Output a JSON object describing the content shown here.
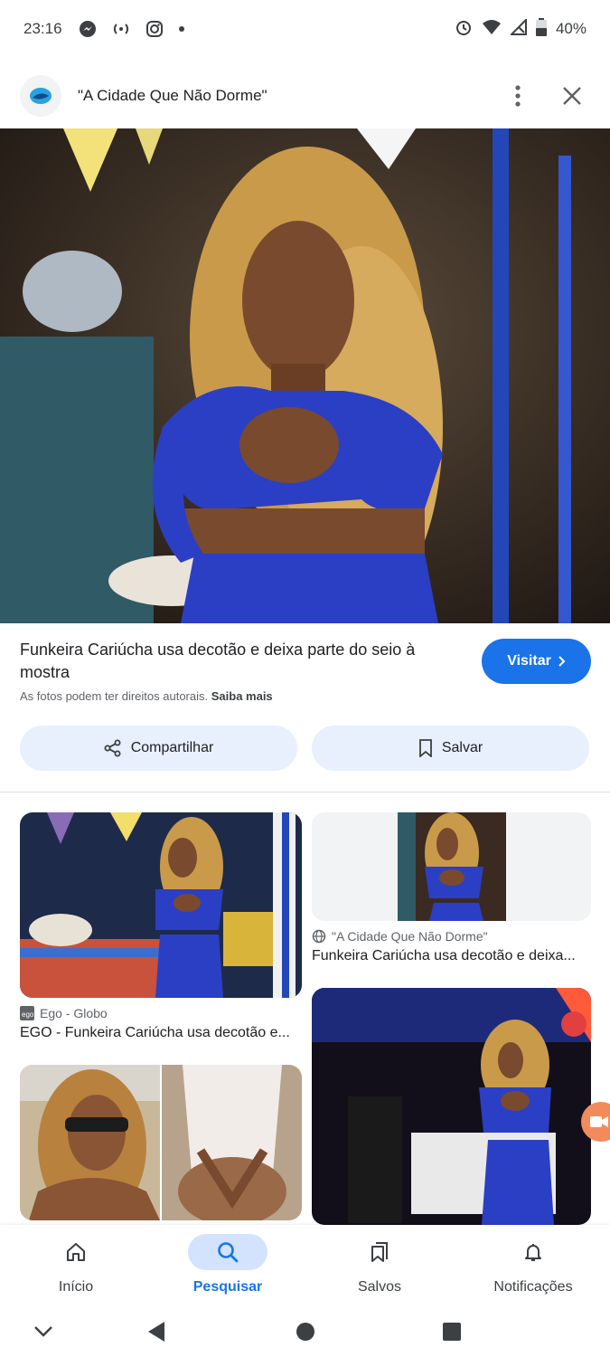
{
  "status_bar": {
    "time": "23:16",
    "battery": "40%",
    "icons": [
      "messenger-icon",
      "broadcast-icon",
      "instagram-icon",
      "dot-icon",
      "alarm-icon",
      "wifi-icon",
      "signal-icon",
      "battery-icon"
    ]
  },
  "header": {
    "title": "\"A Cidade Que Não Dorme\""
  },
  "result": {
    "caption": "Funkeira Cariúcha usa decotão e deixa parte do seio à mostra",
    "visit_label": "Visitar",
    "rights_text": "As fotos podem ter direitos autorais.",
    "learn_more": "Saiba mais",
    "share_label": "Compartilhar",
    "save_label": "Salvar"
  },
  "related": [
    {
      "source": "Ego - Globo",
      "title": "EGO - Funkeira Cariúcha usa decotão e..."
    },
    {
      "source": "\"A Cidade Que Não Dorme\"",
      "title": "Funkeira Cariúcha usa decotão e deixa..."
    }
  ],
  "bottom_nav": [
    {
      "label": "Início",
      "icon": "home-icon"
    },
    {
      "label": "Pesquisar",
      "icon": "search-icon"
    },
    {
      "label": "Salvos",
      "icon": "bookmarks-icon"
    },
    {
      "label": "Notificações",
      "icon": "bell-icon"
    }
  ],
  "colors": {
    "accent": "#1a73e8",
    "pill_bg": "#e8f0fe",
    "active_nav_bg": "#d3e3fd",
    "dress_blue": "#2b3fc4"
  }
}
